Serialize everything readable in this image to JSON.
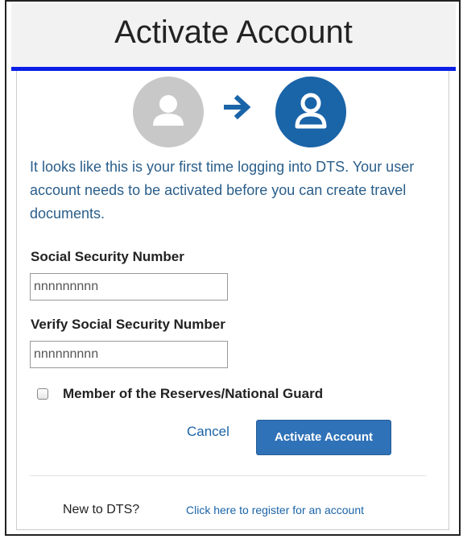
{
  "header": {
    "title": "Activate Account"
  },
  "graphic": {
    "inactive_user_icon": "user-icon",
    "arrow_icon": "arrow-right-icon",
    "active_user_icon": "user-icon",
    "inactive_color": "#c8c8c8",
    "active_color": "#1a64a8"
  },
  "intro": {
    "text": "It looks like this is your first time logging into DTS. Your user account needs to be activated before you can create travel documents."
  },
  "form": {
    "ssn_label": "Social Security Number",
    "ssn_placeholder": "nnnnnnnnn",
    "ssn_value": "",
    "verify_label": "Verify Social Security Number",
    "verify_placeholder": "nnnnnnnnn",
    "verify_value": "",
    "reserves_label": "Member of the Reserves/National Guard",
    "reserves_checked": false
  },
  "actions": {
    "cancel_label": "Cancel",
    "activate_label": "Activate Account",
    "accent_color": "#2f72b8"
  },
  "footer": {
    "new_label": "New to DTS?",
    "register_link": "Click here to register for an account"
  }
}
